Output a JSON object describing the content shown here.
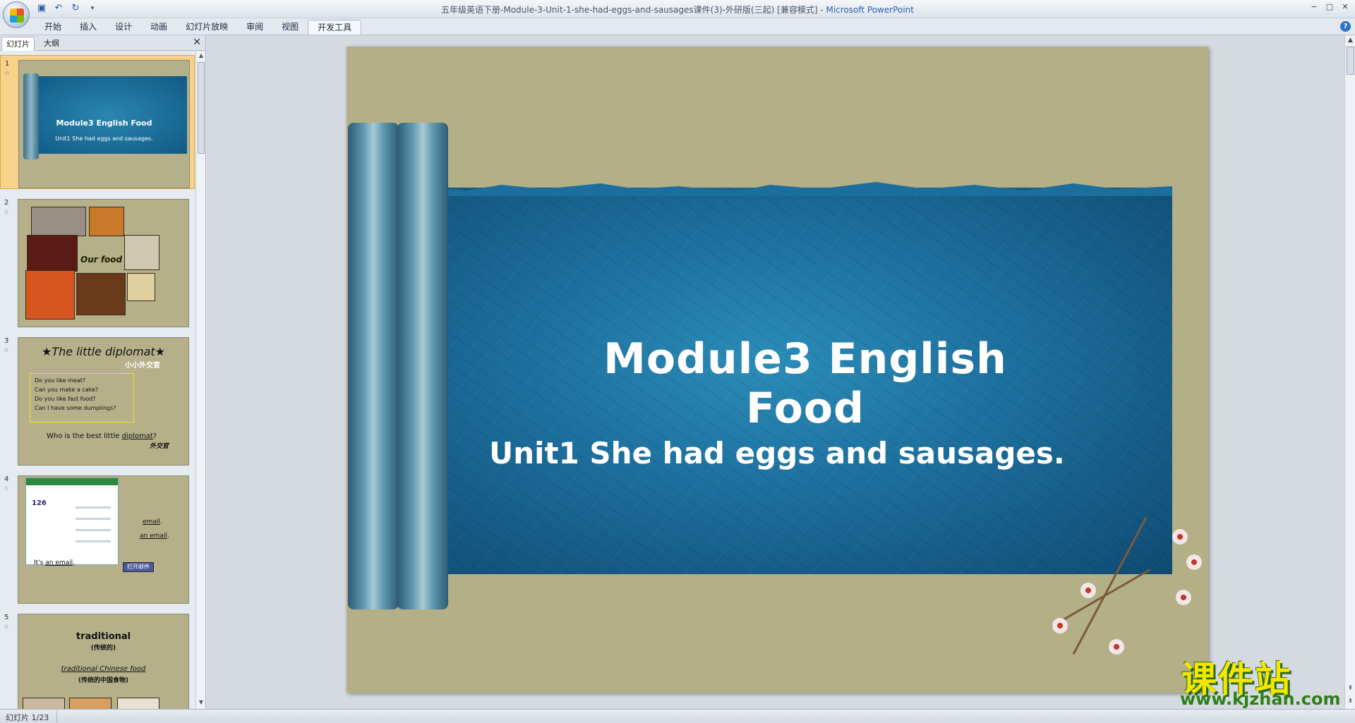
{
  "window": {
    "title": "五年级英语下册-Module-3-Unit-1-she-had-eggs-and-sausages课件(3)-外研版(三起) [兼容模式] - ",
    "app_name": "Microsoft PowerPoint",
    "controls": [
      "−",
      "□",
      "✕"
    ]
  },
  "qat": {
    "icons": [
      "save-icon",
      "undo-icon",
      "redo-icon",
      "customize-icon"
    ]
  },
  "ribbon": {
    "tabs": [
      {
        "label": "开始"
      },
      {
        "label": "插入"
      },
      {
        "label": "设计"
      },
      {
        "label": "动画"
      },
      {
        "label": "幻灯片放映"
      },
      {
        "label": "审阅"
      },
      {
        "label": "视图"
      },
      {
        "label": "开发工具"
      }
    ],
    "active_index": 7,
    "help": "?"
  },
  "left_panel": {
    "tab_slides": "幻灯片",
    "tab_outline": "大纲",
    "close": "✕",
    "thumbnails": [
      {
        "num": "1",
        "title": "Module3  English Food",
        "subtitle": "Unit1  She had eggs and sausages."
      },
      {
        "num": "2",
        "label": "Our food"
      },
      {
        "num": "3",
        "title": "★The little diplomat★",
        "sub": "小小外交官",
        "questions": [
          "Do you like meat?",
          "Can you make a cake?",
          "Do you like fast food?",
          "Can I have some dumplings?"
        ],
        "q_prefix": "Who is the best little ",
        "q_word": "diplomat",
        "q_suffix": "?",
        "answer": "外交官"
      },
      {
        "num": "4",
        "mail_logo": "126",
        "l1": "email",
        "l1_suffix": ".",
        "l2": "an email",
        "l2_suffix": ".",
        "l3_prefix": "It's ",
        "l3": "an email",
        "l3_suffix": ".",
        "btn": "打开邮件"
      },
      {
        "num": "5",
        "a": "traditional",
        "b": "(传统的)",
        "c": "traditional Chinese food",
        "d": "(传统的中国食物)"
      }
    ]
  },
  "slide": {
    "title": "Module3  English Food",
    "subtitle": "Unit1  She had eggs and sausages.",
    "bg_color": "#b3af86",
    "paper_color": "#1c6e9c"
  },
  "watermark": {
    "cn": "课件站",
    "url": "www.kjzhan.com"
  },
  "status": {
    "slide_info": "幻灯片 1/23"
  }
}
